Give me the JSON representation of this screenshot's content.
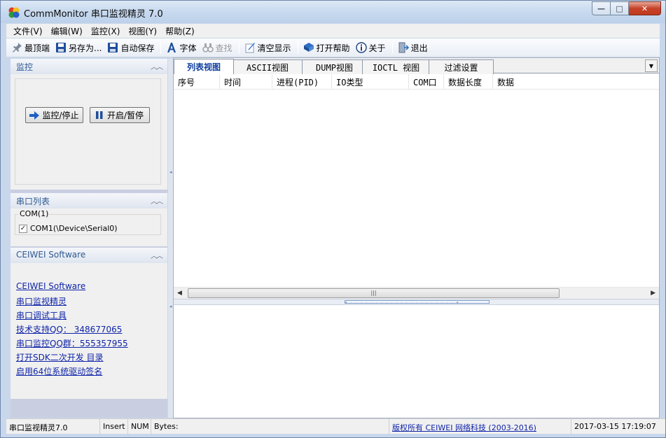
{
  "window": {
    "title": "CommMonitor 串口监视精灵 7.0",
    "minimize_glyph": "—",
    "maximize_glyph": "□",
    "close_glyph": "✕"
  },
  "menu": [
    "文件(V)",
    "编辑(W)",
    "监控(X)",
    "视图(Y)",
    "帮助(Z)"
  ],
  "toolbar": {
    "topmost": "最顶端",
    "save_as": "另存为...",
    "auto_save": "自动保存",
    "font": "字体",
    "find": "查找",
    "clear": "清空显示",
    "help": "打开帮助",
    "about": "关于",
    "exit": "退出"
  },
  "sidebar": {
    "monitor": {
      "title": "监控",
      "start_stop": "监控/停止",
      "pause": "开启/暂停"
    },
    "ports": {
      "title": "串口列表",
      "group": "COM(1)",
      "item": "COM1(\\Device\\Serial0)",
      "checked": true
    },
    "vendor": {
      "title": "CEIWEI Software",
      "links": [
        "CEIWEI Software",
        "串口监视精灵",
        "串口调试工具",
        "技术支持QQ：    348677065",
        "串口监控QQ群：555357955",
        "打开SDK二次开发 目录",
        "启用64位系统驱动签名"
      ]
    }
  },
  "tabs": [
    "列表视图",
    "ASCII视图",
    "DUMP视图",
    "IOCTL 视图",
    "过滤设置"
  ],
  "active_tab": 0,
  "columns": [
    "序号",
    "时间",
    "进程(PID)",
    "IO类型",
    "COM口",
    "数据长度",
    "数据"
  ],
  "statusbar": {
    "app": "串口监视精灵7.0",
    "mode": "Insert",
    "num": "NUM",
    "bytes": "Bytes:",
    "copyright": "版权所有  CEIWEI 网络科技 (2003-2016)",
    "datetime": "2017-03-15 17:19:07"
  },
  "colors": {
    "titlebar": "#c6d8ee",
    "section_title": "#2f5a93",
    "link": "#0f24a8",
    "active_tab_text": "#1040a0"
  }
}
